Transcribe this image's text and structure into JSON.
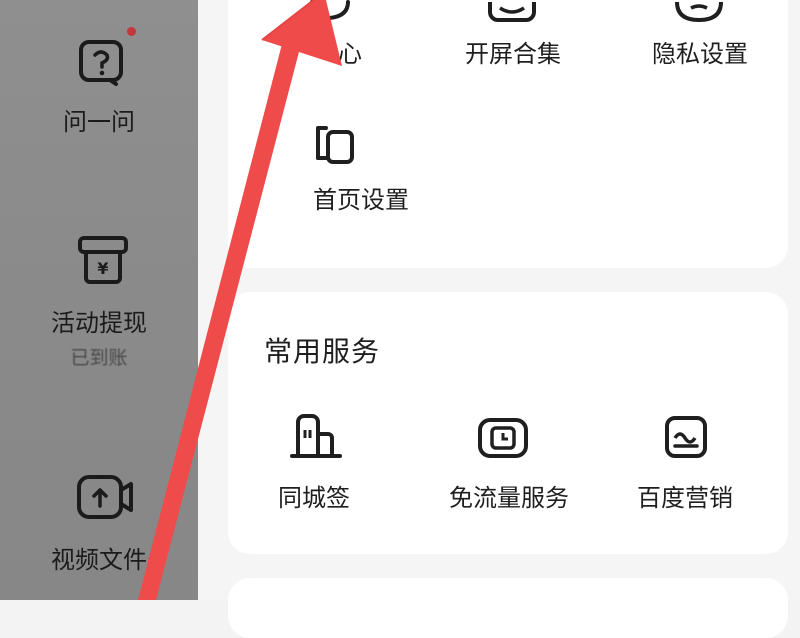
{
  "sidebar": {
    "items": [
      {
        "label": "问一问",
        "icon": "question-icon",
        "has_badge": true
      },
      {
        "label": "活动提现",
        "sublabel": "已到账",
        "icon": "wallet-icon"
      },
      {
        "label": "视频文件",
        "icon": "video-upload-icon"
      }
    ]
  },
  "settings_card": {
    "items": [
      {
        "label": "心",
        "icon": "heart-icon"
      },
      {
        "label": "开屏合集",
        "icon": "splash-collection-icon"
      },
      {
        "label": "隐私设置",
        "icon": "privacy-icon"
      },
      {
        "label": "首页设置",
        "icon": "homepage-settings-icon"
      }
    ]
  },
  "common_services": {
    "title": "常用服务",
    "items": [
      {
        "label": "同城签",
        "icon": "city-building-icon"
      },
      {
        "label": "免流量服务",
        "icon": "data-free-icon"
      },
      {
        "label": "百度营销",
        "icon": "marketing-icon"
      }
    ]
  },
  "colors": {
    "annotation_arrow": "#ef4b4b",
    "badge": "#c4373b",
    "drawer_overlay": "#8c8c8c"
  }
}
